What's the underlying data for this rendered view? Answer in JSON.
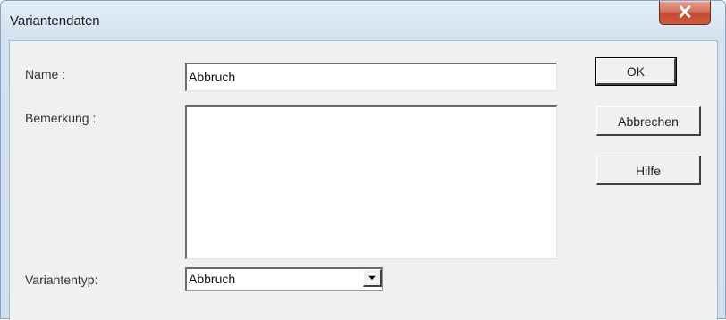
{
  "window": {
    "title": "Variantendaten"
  },
  "form": {
    "name_label": "Name :",
    "name_value": "Abbruch",
    "remark_label": "Bemerkung :",
    "remark_value": "",
    "type_label": "Variantentyp:",
    "type_value": "Abbruch"
  },
  "buttons": {
    "ok": "OK",
    "cancel": "Abbrechen",
    "help": "Hilfe"
  },
  "icons": {
    "close": "close-icon",
    "dropdown": "chevron-down-icon"
  },
  "colors": {
    "close_button": "#c24a31",
    "window_frame": "#d3e2f1",
    "client_bg": "#f0f0f0"
  }
}
